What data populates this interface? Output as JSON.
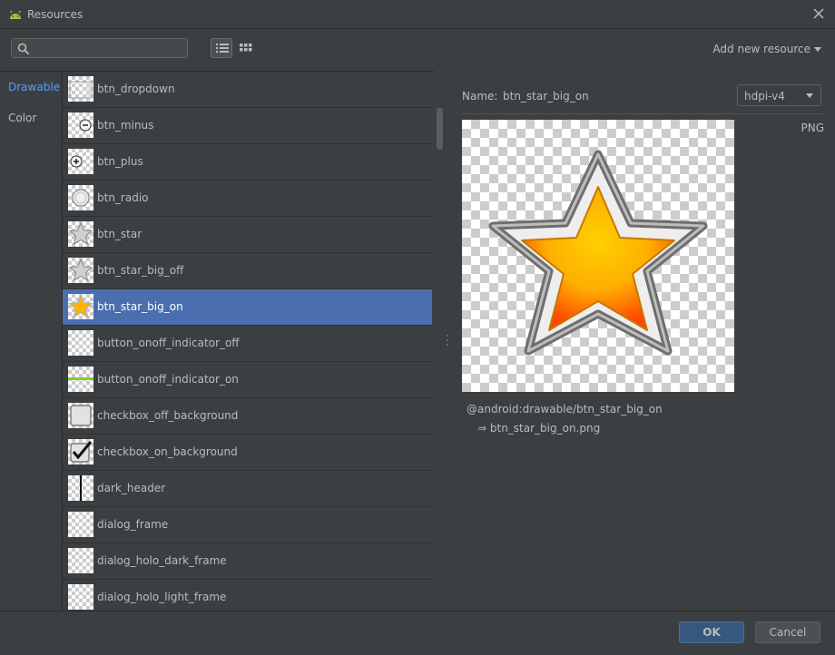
{
  "window": {
    "title": "Resources"
  },
  "search": {
    "placeholder": "",
    "value": ""
  },
  "toolbar": {
    "add_resource_label": "Add new resource"
  },
  "categories": [
    {
      "label": "Drawable",
      "active": true
    },
    {
      "label": "Color",
      "active": false
    }
  ],
  "resources": [
    {
      "name": "btn_dropdown",
      "icon": "dropdown-thumb-icon"
    },
    {
      "name": "btn_minus",
      "icon": "minus-thumb-icon"
    },
    {
      "name": "btn_plus",
      "icon": "plus-thumb-icon"
    },
    {
      "name": "btn_radio",
      "icon": "radio-thumb-icon"
    },
    {
      "name": "btn_star",
      "icon": "star-off-thumb-icon"
    },
    {
      "name": "btn_star_big_off",
      "icon": "star-off-thumb-icon"
    },
    {
      "name": "btn_star_big_on",
      "icon": "star-on-thumb-icon",
      "selected": true
    },
    {
      "name": "button_onoff_indicator_off",
      "icon": "empty-thumb-icon"
    },
    {
      "name": "button_onoff_indicator_on",
      "icon": "green-bar-thumb-icon"
    },
    {
      "name": "checkbox_off_background",
      "icon": "checkbox-off-thumb-icon"
    },
    {
      "name": "checkbox_on_background",
      "icon": "checkbox-on-thumb-icon"
    },
    {
      "name": "dark_header",
      "icon": "dark-header-thumb-icon"
    },
    {
      "name": "dialog_frame",
      "icon": "empty-thumb-icon"
    },
    {
      "name": "dialog_holo_dark_frame",
      "icon": "empty-thumb-icon"
    },
    {
      "name": "dialog_holo_light_frame",
      "icon": "empty-thumb-icon"
    }
  ],
  "detail": {
    "name_label": "Name:",
    "name_value": "btn_star_big_on",
    "density": "hdpi-v4",
    "format": "PNG",
    "reference": "@android:drawable/btn_star_big_on",
    "file": "⇒ btn_star_big_on.png"
  },
  "footer": {
    "ok_label": "OK",
    "cancel_label": "Cancel"
  },
  "colors": {
    "accent": "#589df6",
    "selection": "#4b6eaf",
    "ok_button": "#365880"
  }
}
